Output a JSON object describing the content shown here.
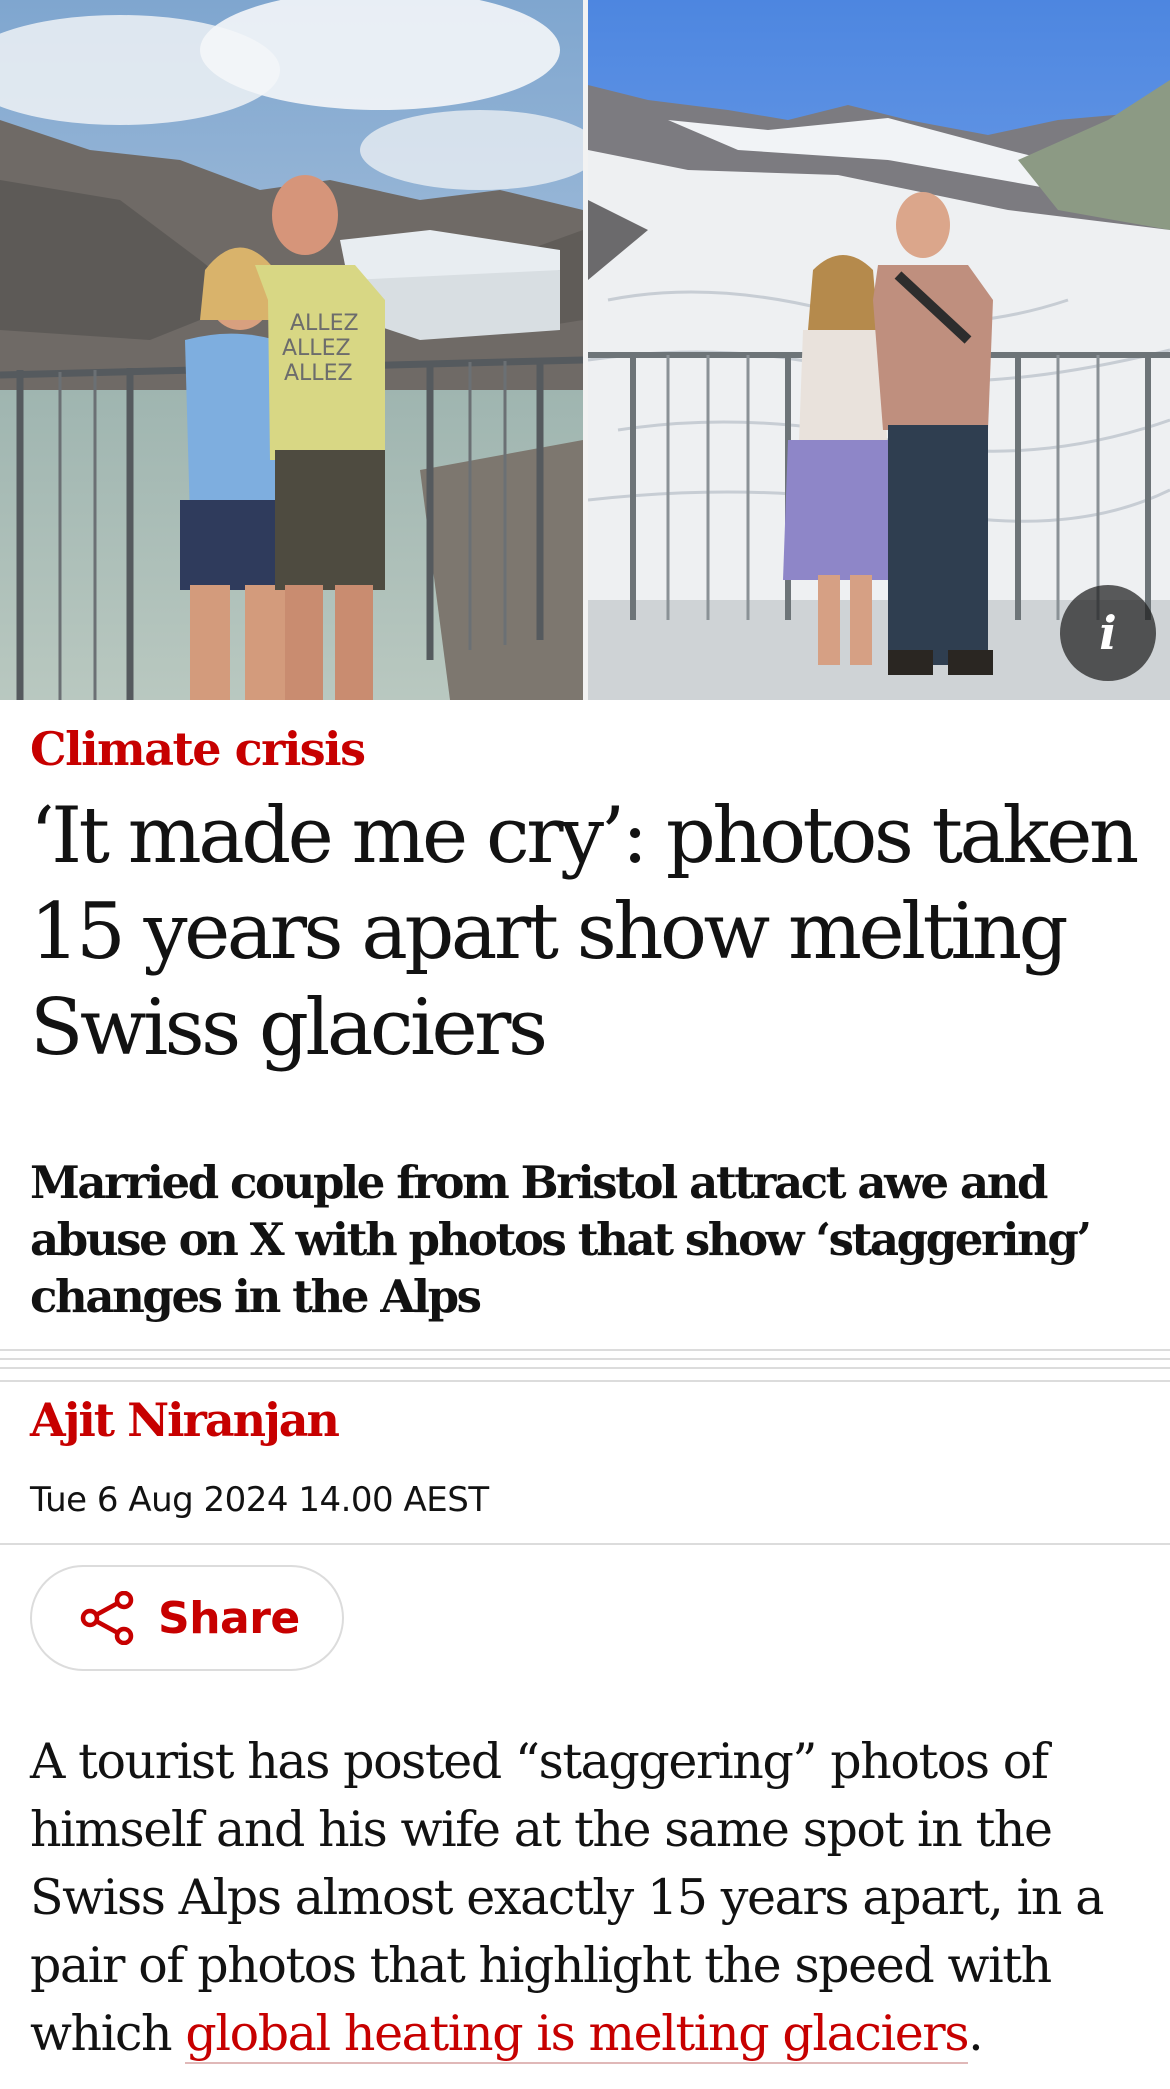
{
  "hero": {
    "info_label": "i",
    "left_photo_desc": "2024 photo",
    "right_photo_desc": "2009 photo",
    "left_shirt_text": [
      "ALLEZ",
      "ALLEZ",
      "ALLEZ"
    ]
  },
  "article": {
    "kicker": "Climate crisis",
    "headline": "‘It made me cry’: photos taken 15 years apart show melting Swiss glaciers",
    "standfirst": "Married couple from Bristol attract awe and abuse on X with photos that show ‘staggering’ changes in the Alps",
    "byline": "Ajit Niranjan",
    "dateline": "Tue 6 Aug 2024 14.00 AEST",
    "share_label": "Share",
    "body_intro": "A tourist has posted “staggering” photos of himself and his wife at the same spot in the Swiss Alps almost exactly 15 years apart, in a pair of photos that highlight the speed with which ",
    "body_link": "global heating is melting glaciers",
    "body_end": "."
  },
  "colors": {
    "accent": "#c70000",
    "text": "#121212",
    "rule": "#dcdcdc"
  },
  "icons": {
    "share": "share-icon",
    "info": "info-icon"
  }
}
